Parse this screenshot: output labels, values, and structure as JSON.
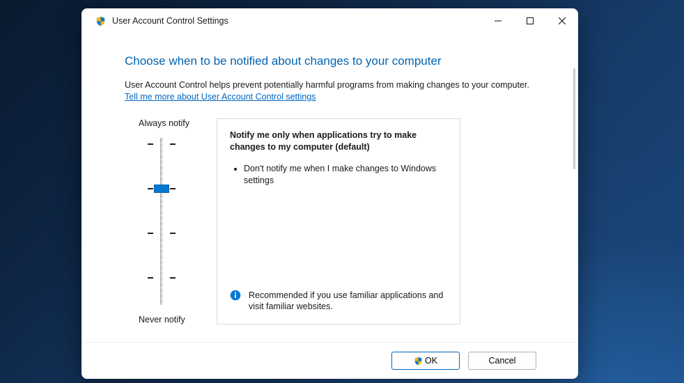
{
  "window": {
    "title": "User Account Control Settings"
  },
  "content": {
    "heading": "Choose when to be notified about changes to your computer",
    "intro": "User Account Control helps prevent potentially harmful programs from making changes to your computer.",
    "help_link": "Tell me more about User Account Control settings"
  },
  "slider": {
    "top_label": "Always notify",
    "bottom_label": "Never notify",
    "levels": 4,
    "selected_level": 2
  },
  "description": {
    "title": "Notify me only when applications try to make changes to my computer (default)",
    "bullet1": "Don't notify me when I make changes to Windows settings",
    "recommendation": "Recommended if you use familiar applications and visit familiar websites."
  },
  "buttons": {
    "ok": "OK",
    "cancel": "Cancel"
  }
}
